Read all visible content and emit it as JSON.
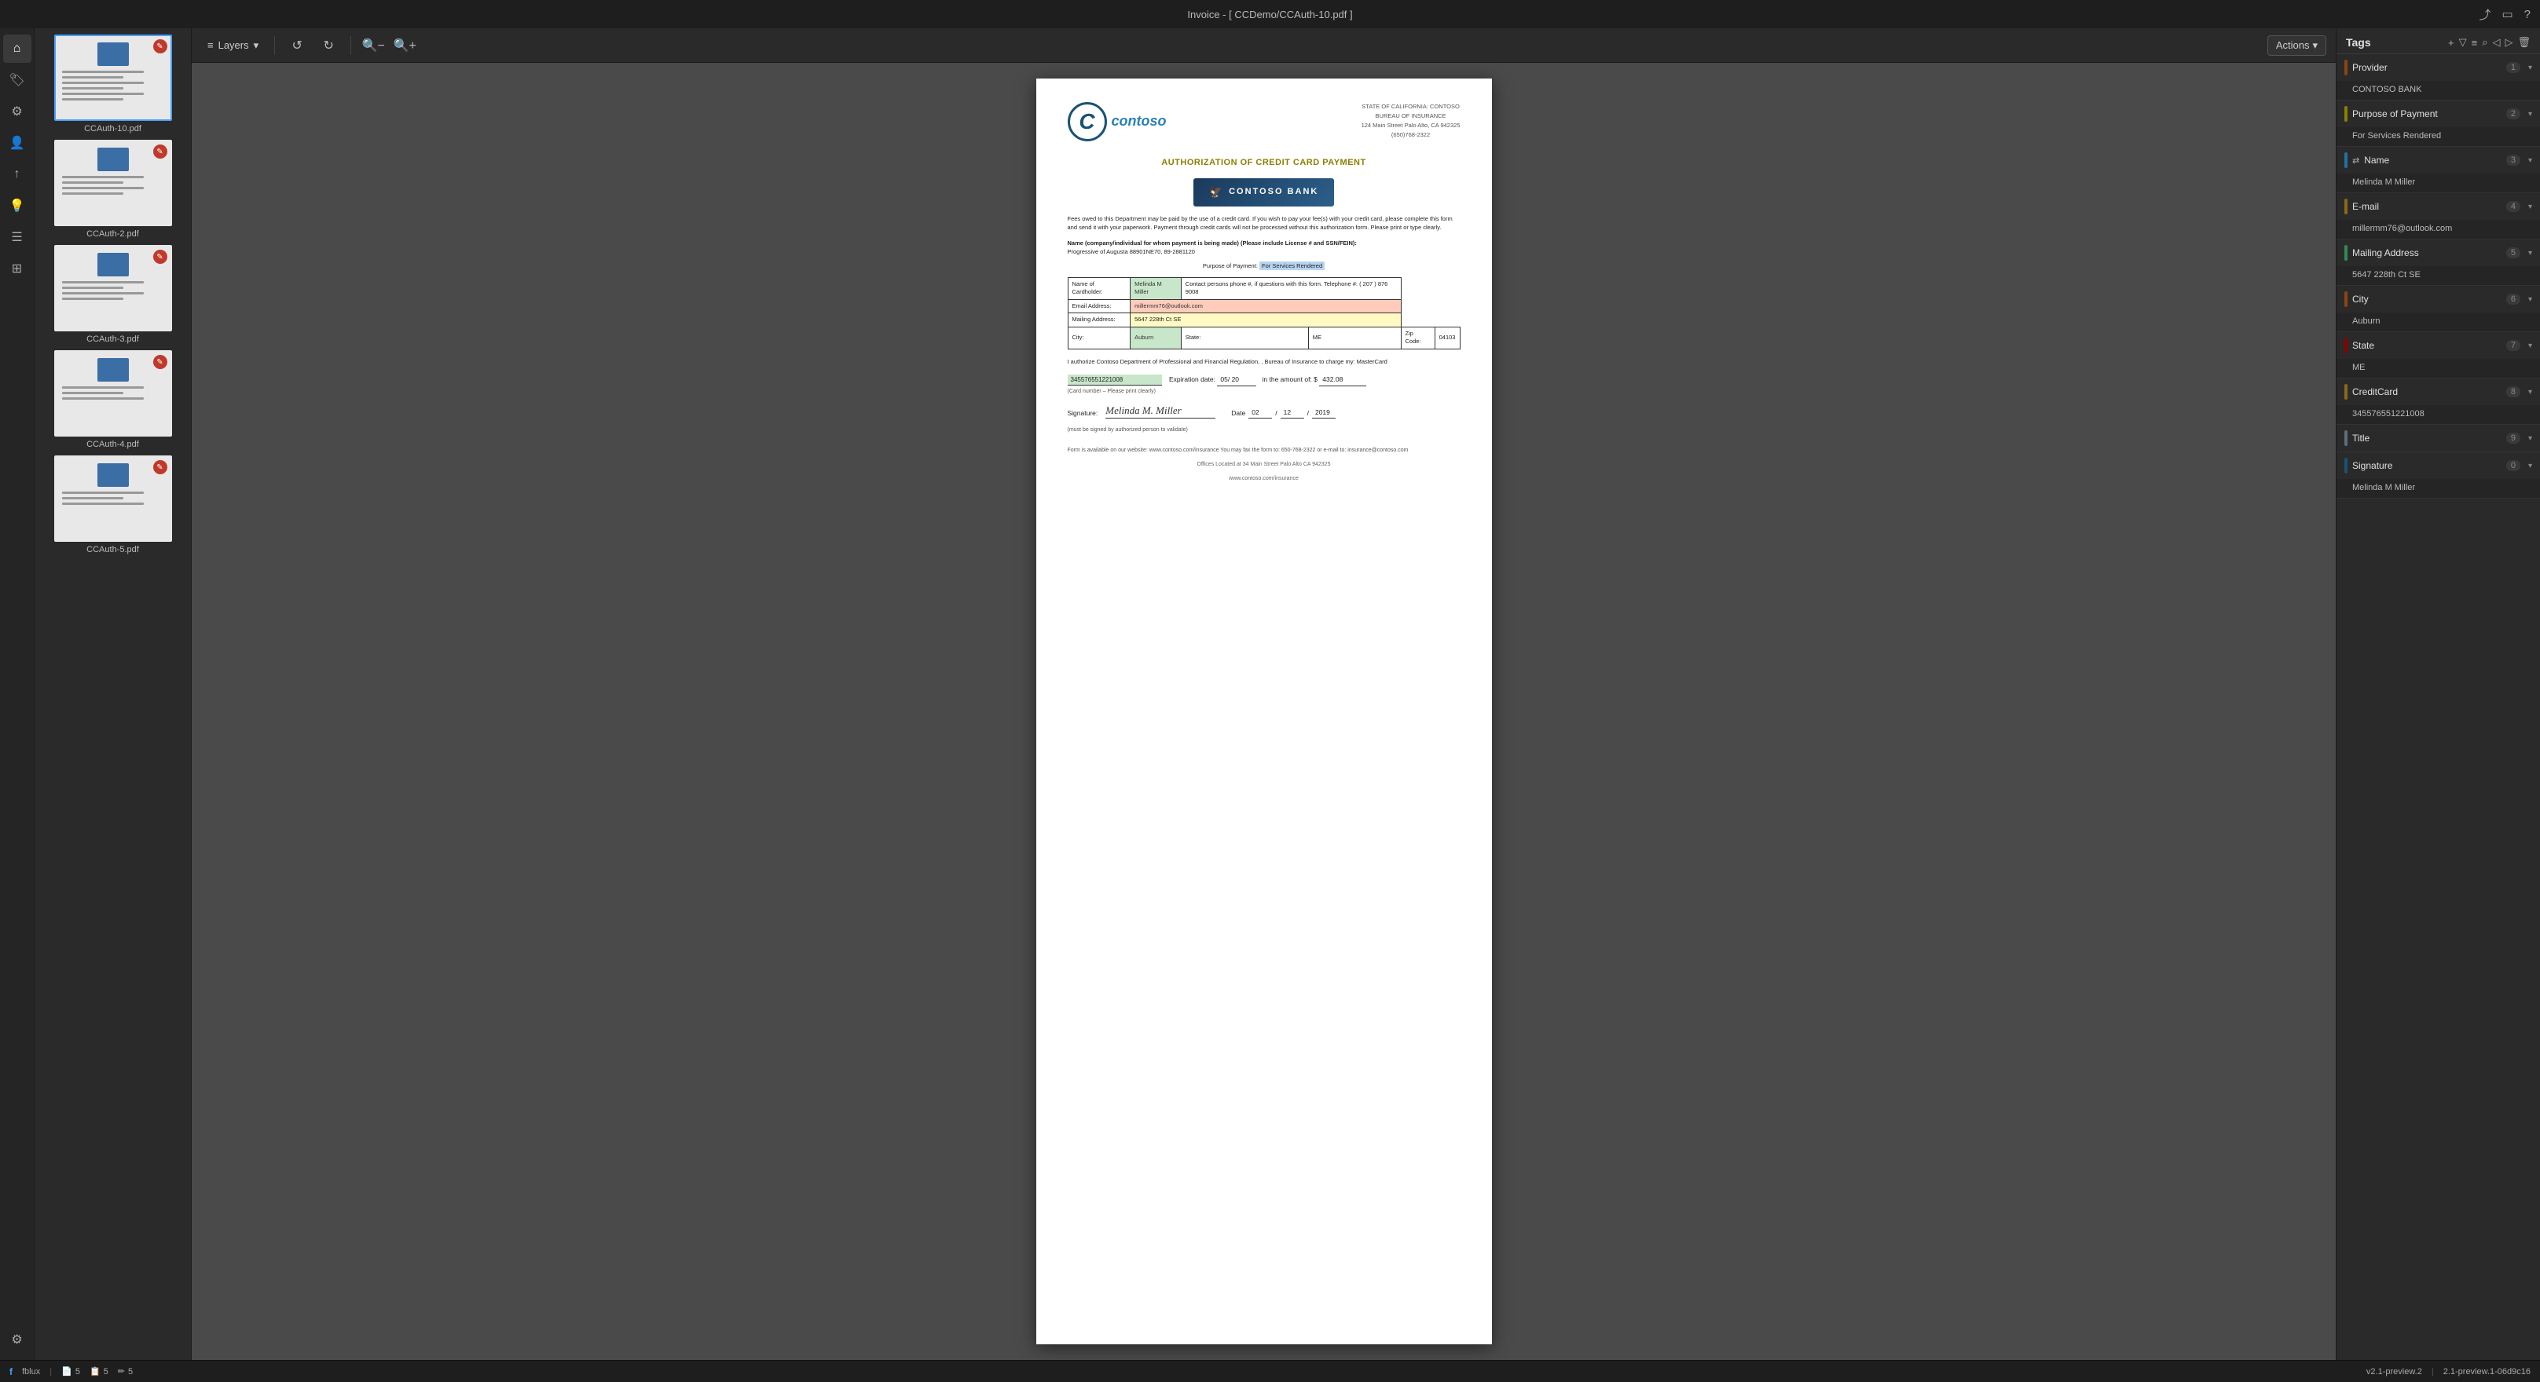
{
  "titleBar": {
    "title": "Invoice - [ CCDemo/CCAuth-10.pdf ]"
  },
  "toolbar": {
    "layers_label": "Layers",
    "actions_label": "Actions"
  },
  "thumbnails": [
    {
      "label": "CCAuth-10.pdf",
      "active": true,
      "badge": true
    },
    {
      "label": "CCAuth-2.pdf",
      "active": false,
      "badge": true
    },
    {
      "label": "CCAuth-3.pdf",
      "active": false,
      "badge": true
    },
    {
      "label": "CCAuth-4.pdf",
      "active": false,
      "badge": true
    },
    {
      "label": "CCAuth-5.pdf",
      "active": false,
      "badge": true
    }
  ],
  "document": {
    "logo_text": "contoso",
    "state_header": "STATE OF CALIFORNIA: CONTOSO",
    "bureau": "BUREAU OF INSURANCE",
    "address": "124 Main Street Palo Alto, CA 942325",
    "phone": "(650)768-2322",
    "title": "AUTHORIZATION OF CREDIT CARD PAYMENT",
    "bank_name": "CONTOSO BANK",
    "fees_text": "Fees owed to this Department may be paid by the use of a credit card.  If you wish to pay your fee(s) with your credit card, please complete this form and send it with your paperwork.  Payment through credit cards will not be processed without this authorization form.  Please print or type clearly.",
    "name_label": "Name (company/individual for whom payment is being made) (Please include License # and SSN/FEIN):",
    "name_value": "Progressive of Augusta  88901NE70,  89-2881120",
    "purpose_label": "Purpose of Payment:",
    "purpose_value": "For Services Rendered",
    "cardholder_label": "Name of Cardholder:",
    "cardholder_value": "Melinda M Miller",
    "contact_label": "Contact persons phone #, if questions with this form. Telephone #:",
    "contact_value": "( 207 )  876  9008",
    "email_label": "Email Address:",
    "email_value": "millermm76@outlook.com",
    "mailing_label": "Mailing Address:",
    "mailing_value": "5647 228th Ct SE",
    "city_label": "City:",
    "city_value": "Auburn",
    "state_label": "State:",
    "state_value": "ME",
    "zip_label": "Zip Code:",
    "zip_value": "04103",
    "authorize_text": "I authorize Contoso Department of Professional and Financial Regulation, , Bureau of Insurance to charge my:  MasterCard",
    "cc_number": "345576551221008",
    "cc_note": "(Card number – Please print clearly)",
    "expiry_label": "Expiration date:",
    "expiry_value": "05/ 20",
    "amount_label": "in the amount of: $",
    "amount_value": "432.08",
    "sig_label": "Signature:",
    "sig_value": "Melinda M. Miller",
    "date_label": "Date",
    "date_month": "02",
    "date_day": "12",
    "date_year": "2019",
    "sig_note": "(must be signed by authorized person to validate)",
    "footer1": "Form is available on our website:  www.contoso.com/insurance  You may fax the form to:  650-768-2322 or e-mail to:  insurance@contoso.com",
    "footer2": "Offices Located at 34 Main Street Palo Alto CA 942325",
    "footer3": "www.contoso.com/insurance"
  },
  "tags": {
    "panel_title": "Tags",
    "items": [
      {
        "name": "Provider",
        "count": 1,
        "color": "#8B4513",
        "value": "CONTOSO BANK"
      },
      {
        "name": "Purpose of Payment",
        "count": 2,
        "color": "#8B8000",
        "value": "For Services Rendered"
      },
      {
        "name": "Name",
        "count": 3,
        "color": "#2471A3",
        "value": "Melinda M Miller"
      },
      {
        "name": "E-mail",
        "count": 4,
        "color": "#8B6914",
        "value": "millermm76@outlook.com"
      },
      {
        "name": "Mailing Address",
        "count": 5,
        "color": "#2E8B57",
        "value": "5647 228th Ct SE"
      },
      {
        "name": "City",
        "count": 6,
        "color": "#8B4513",
        "value": "Auburn"
      },
      {
        "name": "State",
        "count": 7,
        "color": "#8B0000",
        "value": "ME"
      },
      {
        "name": "CreditCard",
        "count": 8,
        "color": "#8B6914",
        "value": "345576551221008"
      },
      {
        "name": "Title",
        "count": 9,
        "color": "#5D6D7E",
        "value": ""
      },
      {
        "name": "Signature",
        "count": 0,
        "color": "#1A5276",
        "value": "Melinda M Miller"
      }
    ]
  },
  "statusBar": {
    "app": "fblux",
    "files": "5",
    "pages": "5",
    "annotations": "5",
    "version": "v2.1-preview.2",
    "build": "2.1-preview.1-06d9c16"
  }
}
